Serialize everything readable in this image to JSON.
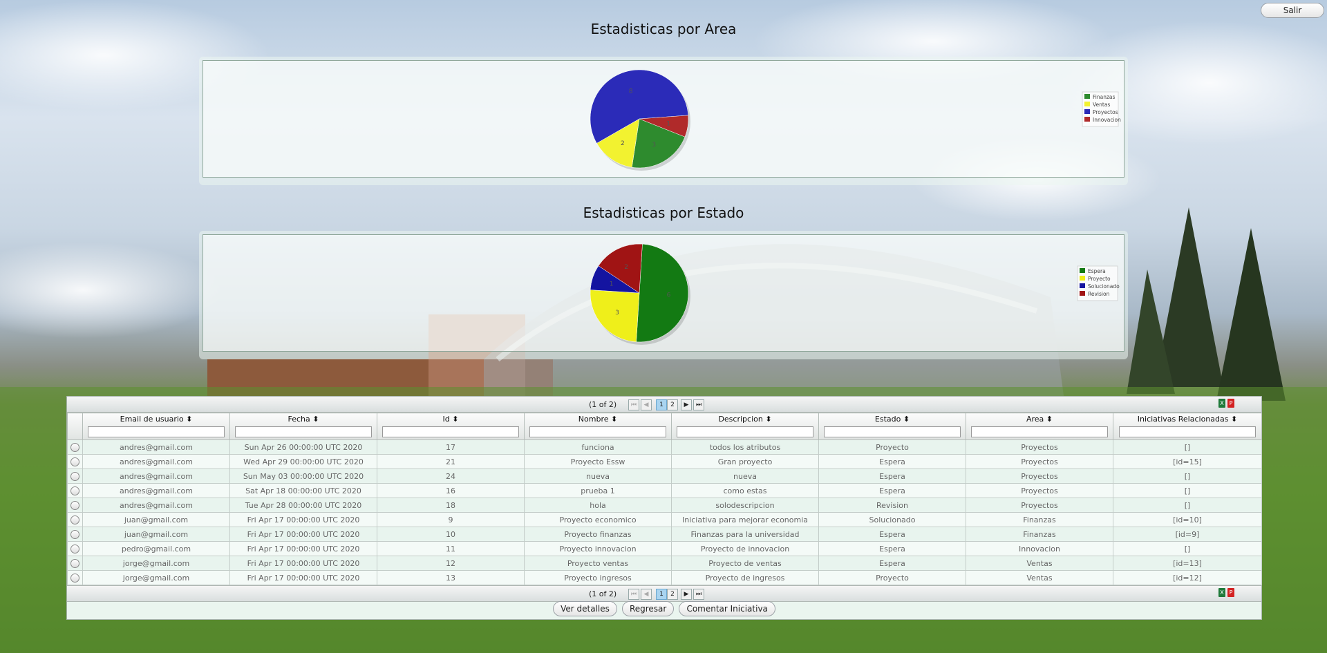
{
  "header": {
    "logout_label": "Salir"
  },
  "section_area": {
    "title": "Estadisticas por Area"
  },
  "section_estado": {
    "title": "Estadisticas por Estado"
  },
  "chart_data": [
    {
      "type": "pie",
      "title": "Estadisticas por Area",
      "categories": [
        "Finanzas",
        "Ventas",
        "Proyectos",
        "Innovacion"
      ],
      "values": [
        3,
        2,
        8,
        1
      ],
      "colors": [
        "#2e8b2e",
        "#f2f230",
        "#2b2bb8",
        "#b02a2a"
      ],
      "legend": "right"
    },
    {
      "type": "pie",
      "title": "Estadisticas por Estado",
      "categories": [
        "Espera",
        "Proyecto",
        "Solucionado",
        "Revision"
      ],
      "values": [
        6,
        3,
        1,
        2
      ],
      "colors": [
        "#137a13",
        "#efef1a",
        "#1414a0",
        "#a01414"
      ],
      "legend": "right"
    }
  ],
  "table": {
    "paginator": {
      "count": "(1 of 2)",
      "pages": [
        "1",
        "2"
      ]
    },
    "columns": [
      "Email de usuario",
      "Fecha",
      "Id",
      "Nombre",
      "Descripcion",
      "Estado",
      "Area",
      "Iniciativas Relacionadas"
    ],
    "rows": [
      [
        "andres@gmail.com",
        "Sun Apr 26 00:00:00 UTC 2020",
        "17",
        "funciona",
        "todos los atributos",
        "Proyecto",
        "Proyectos",
        "[]"
      ],
      [
        "andres@gmail.com",
        "Wed Apr 29 00:00:00 UTC 2020",
        "21",
        "Proyecto Essw",
        "Gran proyecto",
        "Espera",
        "Proyectos",
        "[id=15]"
      ],
      [
        "andres@gmail.com",
        "Sun May 03 00:00:00 UTC 2020",
        "24",
        "nueva",
        "nueva",
        "Espera",
        "Proyectos",
        "[]"
      ],
      [
        "andres@gmail.com",
        "Sat Apr 18 00:00:00 UTC 2020",
        "16",
        "prueba 1",
        "como estas",
        "Espera",
        "Proyectos",
        "[]"
      ],
      [
        "andres@gmail.com",
        "Tue Apr 28 00:00:00 UTC 2020",
        "18",
        "hola",
        "solodescripcion",
        "Revision",
        "Proyectos",
        "[]"
      ],
      [
        "juan@gmail.com",
        "Fri Apr 17 00:00:00 UTC 2020",
        "9",
        "Proyecto economico",
        "Iniciativa para mejorar economia",
        "Solucionado",
        "Finanzas",
        "[id=10]"
      ],
      [
        "juan@gmail.com",
        "Fri Apr 17 00:00:00 UTC 2020",
        "10",
        "Proyecto finanzas",
        "Finanzas para la universidad",
        "Espera",
        "Finanzas",
        "[id=9]"
      ],
      [
        "pedro@gmail.com",
        "Fri Apr 17 00:00:00 UTC 2020",
        "11",
        "Proyecto innovacion",
        "Proyecto de innovacion",
        "Espera",
        "Innovacion",
        "[]"
      ],
      [
        "jorge@gmail.com",
        "Fri Apr 17 00:00:00 UTC 2020",
        "12",
        "Proyecto ventas",
        "Proyecto de ventas",
        "Espera",
        "Ventas",
        "[id=13]"
      ],
      [
        "jorge@gmail.com",
        "Fri Apr 17 00:00:00 UTC 2020",
        "13",
        "Proyecto ingresos",
        "Proyecto de ingresos",
        "Proyecto",
        "Ventas",
        "[id=12]"
      ]
    ]
  },
  "actions": {
    "details_label": "Ver detalles",
    "back_label": "Regresar",
    "comment_label": "Comentar Iniciativa"
  }
}
